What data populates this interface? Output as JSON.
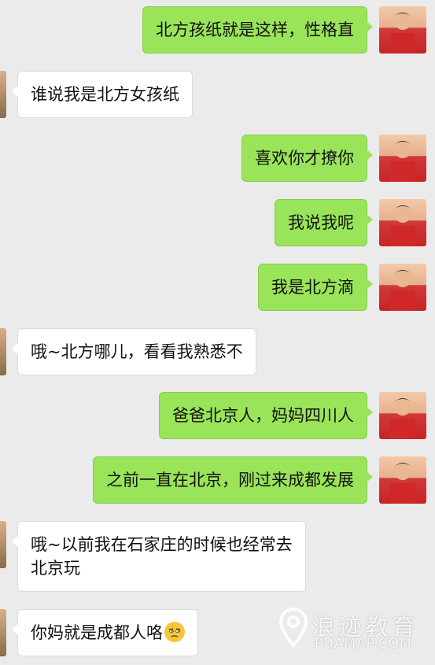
{
  "messages": [
    {
      "side": "sent",
      "text": "北方孩纸就是这样，性格直"
    },
    {
      "side": "recv",
      "text": "谁说我是北方女孩纸"
    },
    {
      "side": "sent",
      "text": "喜欢你才撩你"
    },
    {
      "side": "sent",
      "text": "我说我呢"
    },
    {
      "side": "sent",
      "text": "我是北方滴"
    },
    {
      "side": "recv",
      "text": "哦~北方哪儿，看看我熟悉不"
    },
    {
      "side": "sent",
      "text": "爸爸北京人，妈妈四川人"
    },
    {
      "side": "sent",
      "text": "之前一直在北京，刚过来成都发展"
    },
    {
      "side": "recv",
      "line1": "哦~以前我在石家庄的时候也经常去",
      "line2": "北京玩"
    },
    {
      "side": "recv",
      "text": "你妈就是成都人咯",
      "emoji": "skeptical-face-emoji"
    }
  ],
  "watermark": {
    "cn": "浪迹教育",
    "en": "PUAMAP.COM"
  },
  "colors": {
    "sent_bubble": "#9ae45a",
    "recv_bubble": "#ffffff",
    "background": "#ebebeb"
  }
}
